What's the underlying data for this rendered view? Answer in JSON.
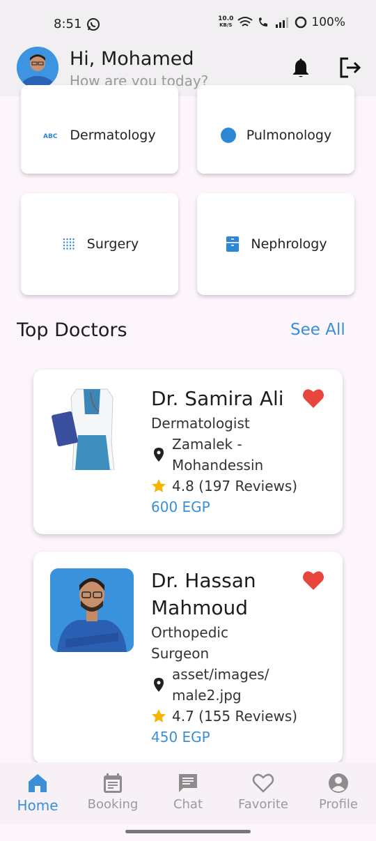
{
  "status": {
    "time": "8:51",
    "speed_top": "10.0",
    "speed_unit": "KB/S",
    "battery": "100%"
  },
  "header": {
    "greeting": "Hi, Mohamed",
    "subtitle": "How are you today?"
  },
  "specialties": [
    {
      "label": "Dermatology",
      "icon": "abc-icon"
    },
    {
      "label": "Pulmonology",
      "icon": "circle-icon"
    },
    {
      "label": "Surgery",
      "icon": "dots-grid-icon"
    },
    {
      "label": "Nephrology",
      "icon": "cabinet-icon"
    }
  ],
  "section": {
    "title": "Top Doctors",
    "see_all": "See All"
  },
  "doctors": [
    {
      "name": "Dr. Samira Ali",
      "specialty": "Dermatologist",
      "address_line1": "Zamalek -",
      "address_line2": "Mohandessin",
      "rating": "4.8 (197 Reviews)",
      "price": "600 EGP"
    },
    {
      "name_line1": "Dr. Hassan",
      "name_line2": "Mahmoud",
      "specialty_line1": "Orthopedic",
      "specialty_line2": "Surgeon",
      "address_line1": "asset/images/",
      "address_line2": "male2.jpg",
      "rating": "4.7 (155 Reviews)",
      "price": "450 EGP"
    }
  ],
  "nav": [
    {
      "label": "Home",
      "icon": "home-icon",
      "active": true
    },
    {
      "label": "Booking",
      "icon": "calendar-icon",
      "active": false
    },
    {
      "label": "Chat",
      "icon": "chat-icon",
      "active": false
    },
    {
      "label": "Favorite",
      "icon": "heart-outline-icon",
      "active": false
    },
    {
      "label": "Profile",
      "icon": "profile-icon",
      "active": false
    }
  ],
  "colors": {
    "accent": "#3a8fd6",
    "heart": "#e8453c",
    "star": "#f5b400",
    "background": "#fcf5fc"
  }
}
